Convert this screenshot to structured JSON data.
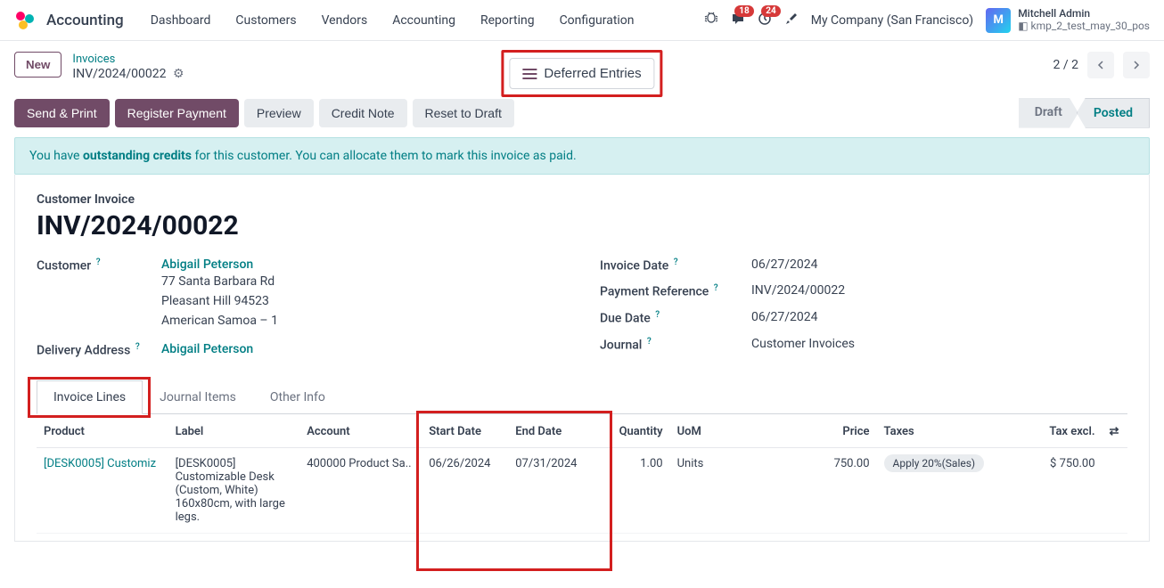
{
  "app": {
    "name": "Accounting"
  },
  "nav": [
    "Dashboard",
    "Customers",
    "Vendors",
    "Accounting",
    "Reporting",
    "Configuration"
  ],
  "tray": {
    "messages_badge": "18",
    "activities_badge": "24",
    "company": "My Company (San Francisco)"
  },
  "user": {
    "name": "Mitchell Admin",
    "db": "kmp_2_test_may_30_pos",
    "initials": "M"
  },
  "control": {
    "new_label": "New",
    "breadcrumb_parent": "Invoices",
    "breadcrumb_record": "INV/2024/00022",
    "deferred_label": "Deferred Entries",
    "pager": "2 / 2"
  },
  "actions": {
    "send_print": "Send & Print",
    "register_payment": "Register Payment",
    "preview": "Preview",
    "credit_note": "Credit Note",
    "reset_draft": "Reset to Draft"
  },
  "status": {
    "draft": "Draft",
    "posted": "Posted"
  },
  "banner": {
    "pre": "You have ",
    "bold": "outstanding credits",
    "post": " for this customer. You can allocate them to mark this invoice as paid."
  },
  "form": {
    "subtitle": "Customer Invoice",
    "title": "INV/2024/00022",
    "labels": {
      "customer": "Customer",
      "delivery": "Delivery Address",
      "invoice_date": "Invoice Date",
      "payment_ref": "Payment Reference",
      "due_date": "Due Date",
      "journal": "Journal"
    },
    "customer": {
      "name": "Abigail Peterson",
      "street": "77 Santa Barbara Rd",
      "city": "Pleasant Hill 94523",
      "country": "American Samoa – 1"
    },
    "delivery_name": "Abigail Peterson",
    "invoice_date": "06/27/2024",
    "payment_ref": "INV/2024/00022",
    "due_date": "06/27/2024",
    "journal": "Customer Invoices"
  },
  "tabs": [
    "Invoice Lines",
    "Journal Items",
    "Other Info"
  ],
  "columns": {
    "product": "Product",
    "label": "Label",
    "account": "Account",
    "start": "Start Date",
    "end": "End Date",
    "quantity": "Quantity",
    "uom": "UoM",
    "price": "Price",
    "taxes": "Taxes",
    "tax_excl": "Tax excl."
  },
  "lines": [
    {
      "product": "[DESK0005] Customiz",
      "label": "[DESK0005] Customizable Desk (Custom, White) 160x80cm, with large legs.",
      "account": "400000 Product Sa..",
      "start": "06/26/2024",
      "end": "07/31/2024",
      "quantity": "1.00",
      "uom": "Units",
      "price": "750.00",
      "tax": "Apply 20%(Sales)",
      "tax_excl": "$ 750.00"
    }
  ]
}
